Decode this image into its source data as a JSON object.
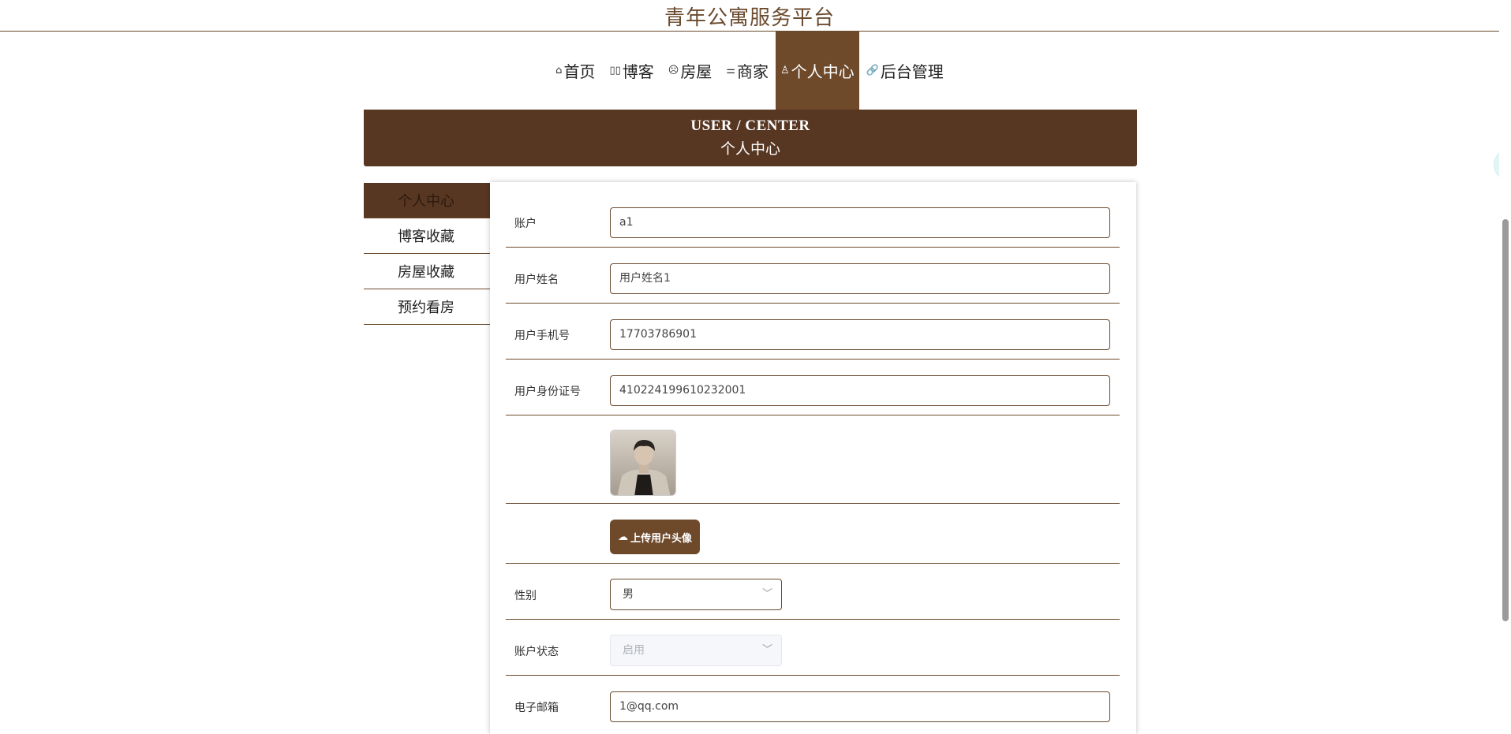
{
  "site": {
    "title": "青年公寓服务平台"
  },
  "nav": [
    {
      "icon": "⌂",
      "label": "首页"
    },
    {
      "icon": "▯▯",
      "label": "博客"
    },
    {
      "icon": "☹",
      "label": "房屋"
    },
    {
      "icon": "⚌",
      "label": "商家"
    },
    {
      "icon": "♙",
      "label": "个人中心",
      "active": true
    },
    {
      "icon": "🔗",
      "label": "后台管理"
    }
  ],
  "banner": {
    "en": "USER / CENTER",
    "cn": "个人中心"
  },
  "sidemenu": [
    "个人中心",
    "博客收藏",
    "房屋收藏",
    "预约看房"
  ],
  "form": {
    "account": {
      "label": "账户",
      "value": "a1"
    },
    "name": {
      "label": "用户姓名",
      "value": "用户姓名1"
    },
    "phone": {
      "label": "用户手机号",
      "value": "17703786901"
    },
    "idcard": {
      "label": "用户身份证号",
      "value": "410224199610232001"
    },
    "upload": {
      "label": "上传用户头像"
    },
    "gender": {
      "label": "性别",
      "value": "男"
    },
    "status": {
      "label": "账户状态",
      "value": "启用"
    },
    "email": {
      "label": "电子邮箱",
      "value": "1@qq.com"
    }
  },
  "colors": {
    "brand": "#6e4a2b",
    "banner": "#573622"
  }
}
